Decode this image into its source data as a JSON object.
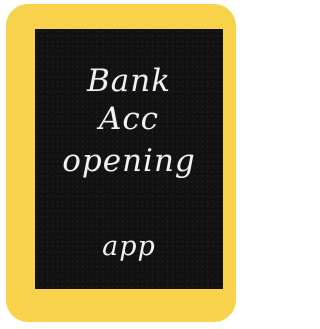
{
  "cover": {
    "line1": "Bank",
    "line2": "Acc",
    "line3": "opening",
    "line4": "app"
  },
  "colors": {
    "frame": "#f8d24a",
    "board": "#111111",
    "text": "#f2f2f2"
  }
}
